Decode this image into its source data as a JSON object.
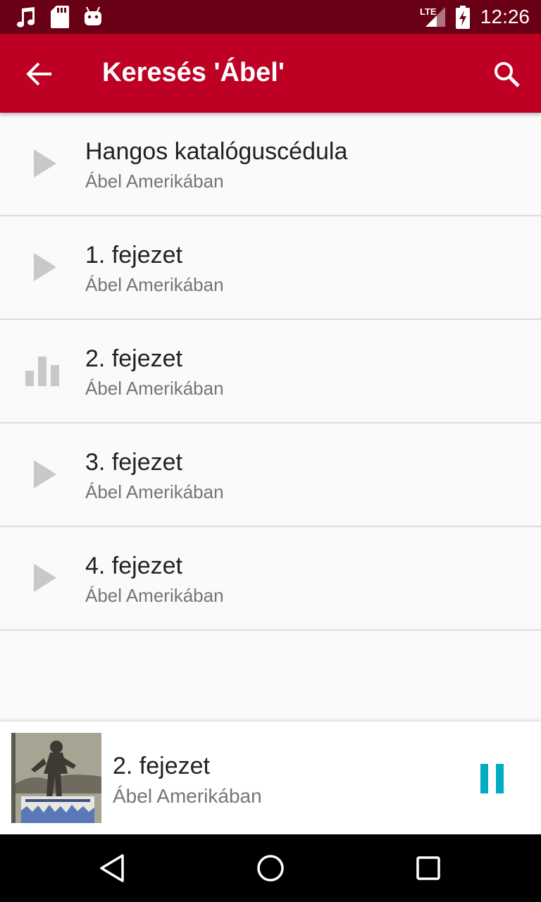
{
  "status_bar": {
    "time": "12:26",
    "network": "LTE",
    "left_icons": [
      "music-note-icon",
      "sd-card-icon",
      "android-icon"
    ],
    "right_icons": [
      "signal-icon",
      "battery-charging-icon"
    ]
  },
  "app_bar": {
    "title": "Keresés 'Ábel'",
    "back_icon": "arrow-back-icon",
    "search_icon": "search-icon",
    "color": "#be0025"
  },
  "items": [
    {
      "title": "Hangos katalóguscédula",
      "subtitle": "Ábel Amerikában",
      "icon": "play-icon"
    },
    {
      "title": "1. fejezet",
      "subtitle": "Ábel Amerikában",
      "icon": "play-icon"
    },
    {
      "title": "2. fejezet",
      "subtitle": "Ábel Amerikában",
      "icon": "equalizer-icon"
    },
    {
      "title": "3. fejezet",
      "subtitle": "Ábel Amerikában",
      "icon": "play-icon"
    },
    {
      "title": "4. fejezet",
      "subtitle": "Ábel Amerikában",
      "icon": "play-icon"
    }
  ],
  "now_playing": {
    "title": "2. fejezet",
    "subtitle": "Ábel Amerikában",
    "control_icon": "pause-icon",
    "accent_color": "#00acc1"
  },
  "nav_bar": {
    "icons": [
      "back-triangle-icon",
      "home-circle-icon",
      "recents-square-icon"
    ]
  }
}
